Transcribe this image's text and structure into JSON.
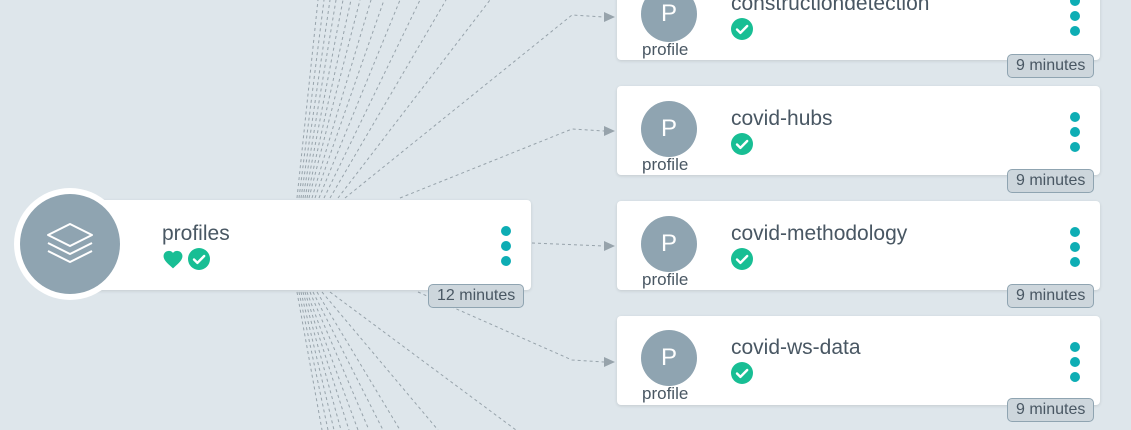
{
  "app": {
    "name": "profiles",
    "age": "12 minutes",
    "kind_icon": "layers-icon",
    "health_icon": "heart-icon",
    "sync_icon": "check-circle-icon",
    "colors": {
      "healthy": "#18be94",
      "menu": "#0dadb4",
      "kind_circle": "#8fa4b1"
    }
  },
  "resources": [
    {
      "name": "constructiondetection",
      "kind_letter": "P",
      "kind_label": "profile",
      "age": "9 minutes",
      "sync_icon": "check-circle-icon"
    },
    {
      "name": "covid-hubs",
      "kind_letter": "P",
      "kind_label": "profile",
      "age": "9 minutes",
      "sync_icon": "check-circle-icon"
    },
    {
      "name": "covid-methodology",
      "kind_letter": "P",
      "kind_label": "profile",
      "age": "9 minutes",
      "sync_icon": "check-circle-icon"
    },
    {
      "name": "covid-ws-data",
      "kind_letter": "P",
      "kind_label": "profile",
      "age": "9 minutes",
      "sync_icon": "check-circle-icon"
    }
  ]
}
